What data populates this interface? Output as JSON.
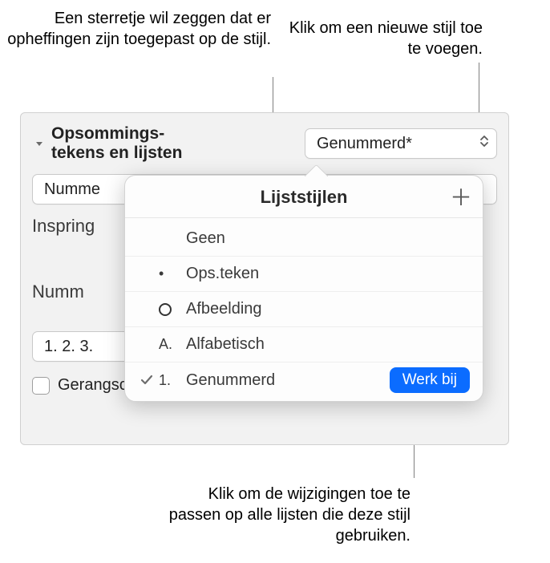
{
  "callouts": {
    "asterisk": "Een sterretje wil zeggen dat er opheffingen zijn toegepast op de stijl.",
    "add": "Klik om een nieuwe stijl toe te voegen.",
    "update": "Klik om de wijzigingen toe te passen op alle lijsten die deze stijl gebruiken."
  },
  "panel": {
    "section_label": "Opsommings­tekens en lijsten",
    "style_select": "Genummerd*",
    "nummer_prefix": "Numme",
    "indent_prefix": "Inspring",
    "numm_prefix": "Numm",
    "number_format": "1. 2. 3.",
    "tiered_label": "Gerangschikte nummers"
  },
  "popover": {
    "title": "Lijststijlen",
    "add_glyph": "＋",
    "items": [
      {
        "selected": false,
        "bullet": "",
        "bullet_type": "none",
        "name": "Geen"
      },
      {
        "selected": false,
        "bullet": "•",
        "bullet_type": "dot",
        "name": "Ops.teken"
      },
      {
        "selected": false,
        "bullet": "",
        "bullet_type": "ring",
        "name": "Afbeelding"
      },
      {
        "selected": false,
        "bullet": "A.",
        "bullet_type": "text",
        "name": "Alfabetisch"
      },
      {
        "selected": true,
        "bullet": "1.",
        "bullet_type": "text",
        "name": "Genummerd"
      }
    ],
    "update_label": "Werk bij"
  }
}
